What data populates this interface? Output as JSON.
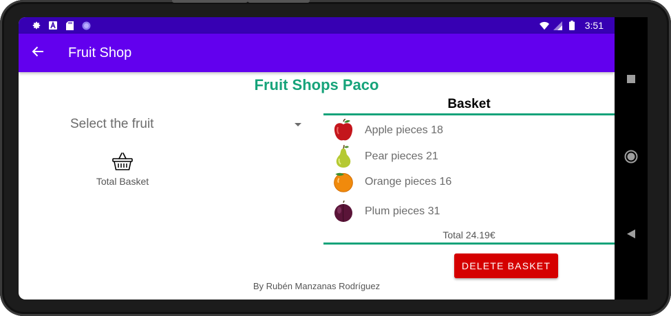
{
  "status_bar": {
    "time": "3:51",
    "icons_left": [
      "settings-icon",
      "a-icon",
      "sd-card-icon",
      "circle-icon"
    ],
    "icons_right": [
      "wifi-icon",
      "signal-icon",
      "battery-icon"
    ]
  },
  "app_bar": {
    "title": "Fruit Shop",
    "back_icon": "arrow-back-icon"
  },
  "main": {
    "title": "Fruit Shops Paco",
    "spinner_placeholder": "Select the fruit",
    "total_basket_label": "Total Basket",
    "basket_title": "Basket",
    "items": [
      {
        "label": "Apple pieces 18",
        "icon": "apple-icon"
      },
      {
        "label": "Pear pieces 21",
        "icon": "pear-icon"
      },
      {
        "label": "Orange pieces 16",
        "icon": "orange-icon"
      },
      {
        "label": "Plum pieces 31",
        "icon": "plum-icon"
      }
    ],
    "total": "Total 24.19€",
    "delete_button": "DELETE BASKET",
    "credits": "By Rubén Manzanas Rodríguez"
  },
  "colors": {
    "status_bar": "#3700b3",
    "app_bar": "#6200ee",
    "accent_green": "#16a37a",
    "delete_red": "#d50000"
  }
}
